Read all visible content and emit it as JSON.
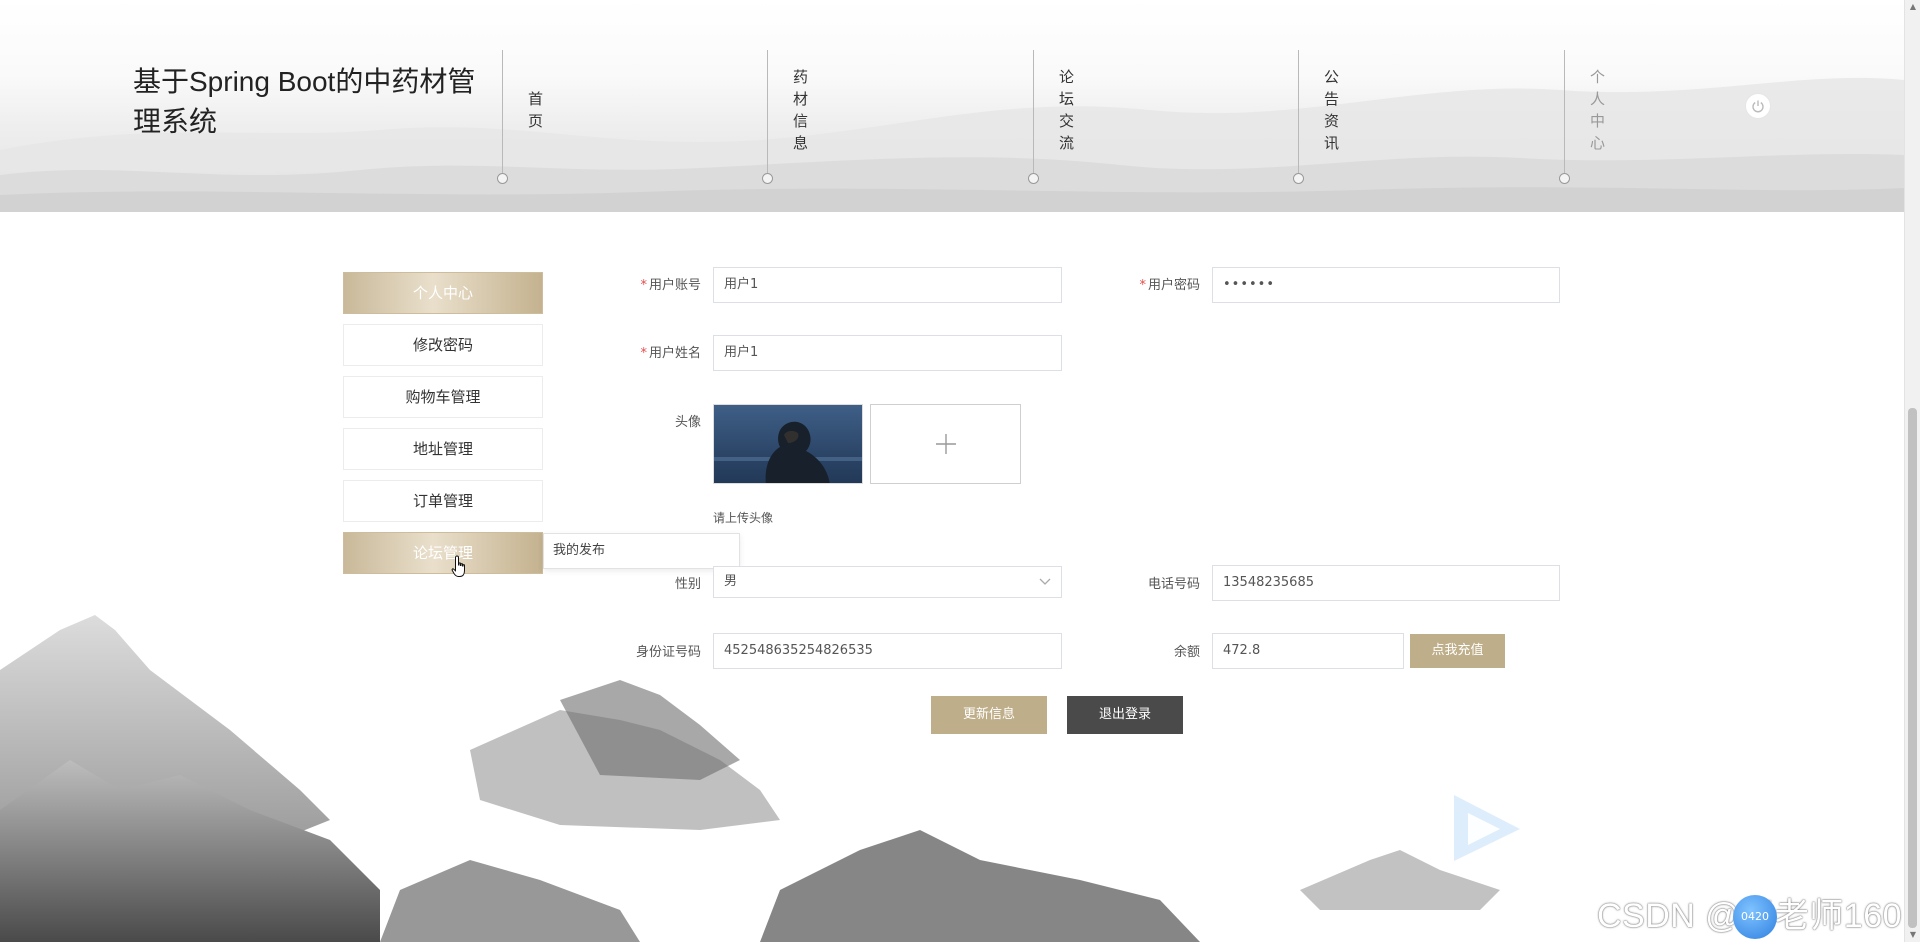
{
  "header": {
    "site_title": "基于Spring Boot的中药材管理系统",
    "nav": [
      {
        "label": "首页"
      },
      {
        "label": "药材信息"
      },
      {
        "label": "论坛交流"
      },
      {
        "label": "公告资讯"
      },
      {
        "label": "个人中心"
      }
    ],
    "active_nav": "个人中心"
  },
  "sidebar": {
    "items": [
      {
        "label": "个人中心"
      },
      {
        "label": "修改密码"
      },
      {
        "label": "购物车管理"
      },
      {
        "label": "地址管理"
      },
      {
        "label": "订单管理"
      },
      {
        "label": "论坛管理"
      }
    ],
    "submenu": {
      "label": "我的发布"
    }
  },
  "form": {
    "username": {
      "label": "用户账号",
      "value": "用户1"
    },
    "password": {
      "label": "用户密码",
      "value": "••••••"
    },
    "name": {
      "label": "用户姓名",
      "value": "用户1"
    },
    "avatar": {
      "label": "头像",
      "hint": "请上传头像"
    },
    "gender": {
      "label": "性别",
      "value": "男"
    },
    "phone": {
      "label": "电话号码",
      "value": "13548235685"
    },
    "id_number": {
      "label": "身份证号码",
      "value": "452548635254826535"
    },
    "balance": {
      "label": "余额",
      "value": "472.8",
      "recharge_label": "点我充值"
    },
    "required_mark": "*"
  },
  "actions": {
    "update_label": "更新信息",
    "logout_label": "退出登录"
  },
  "watermark": {
    "text": "CSDN @王老师160",
    "badge": "0420"
  },
  "colors": {
    "gold": "#bfae8a",
    "dark_button": "#4a4a4a",
    "required": "#e54b4b"
  }
}
